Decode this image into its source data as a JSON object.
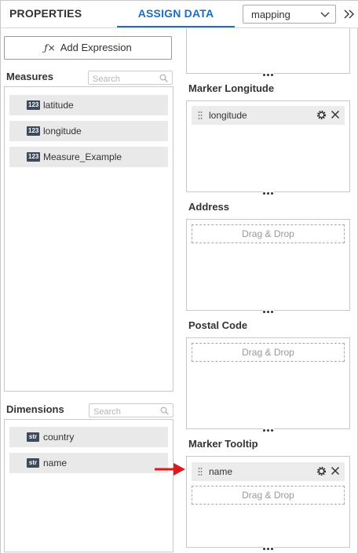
{
  "header": {
    "tabs": [
      {
        "label": "PROPERTIES"
      },
      {
        "label": "ASSIGN DATA"
      }
    ],
    "dataset_select": {
      "value": "mapping"
    }
  },
  "left": {
    "add_expression_label": "Add Expression",
    "add_expression_icon": "fx-icon",
    "measures": {
      "label": "Measures",
      "search_placeholder": "Search",
      "items": [
        {
          "type": "123",
          "name": "latitude"
        },
        {
          "type": "123",
          "name": "longitude"
        },
        {
          "type": "123",
          "name": "Measure_Example"
        }
      ]
    },
    "dimensions": {
      "label": "Dimensions",
      "search_placeholder": "Search",
      "items": [
        {
          "type": "str",
          "name": "country"
        },
        {
          "type": "str",
          "name": "name"
        }
      ]
    }
  },
  "right": {
    "zones": [
      {
        "label": "",
        "chips": []
      },
      {
        "label": "Marker Longitude",
        "chips": [
          "longitude"
        ]
      },
      {
        "label": "Address",
        "drop_text": "Drag & Drop"
      },
      {
        "label": "Postal Code",
        "drop_text": "Drag & Drop"
      },
      {
        "label": "Marker Tooltip",
        "chips": [
          "name"
        ],
        "drop_text": "Drag & Drop"
      }
    ]
  },
  "colors": {
    "accent": "#1b6ec2",
    "badge": "#3d4a5c",
    "arrow": "#e0181b"
  }
}
